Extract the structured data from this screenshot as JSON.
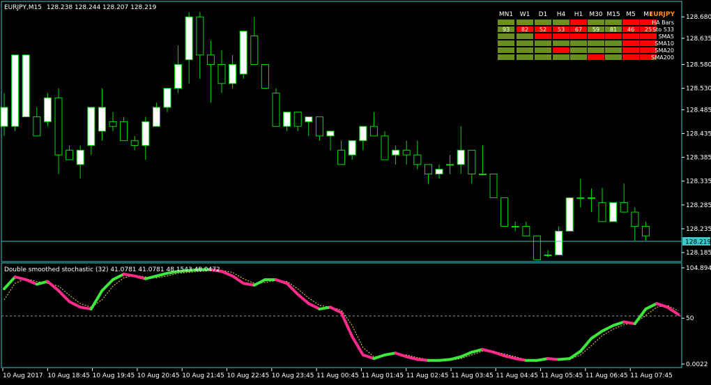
{
  "colors": {
    "background": "#000000",
    "frame": "#3ec9c9",
    "candle_line": "#00dc00",
    "candle_bull": "#ffffff",
    "candle_bear": "#000000",
    "price_line_bg": "#3ec9c9",
    "stoch_up": "#3ee63e",
    "stoch_down": "#ff2a8c",
    "signal": "#ffdd33",
    "mtf_ok": "#6b8e23",
    "mtf_bad": "#ff0000",
    "mtf_symbol": "#ff8c1a"
  },
  "main_header": {
    "symbol_tf": "EURJPY,M15",
    "ohlc": "128.238 128.244 128.207 128.219"
  },
  "current_price": "128.219",
  "sub_header": {
    "text": "Double smoothed stochastic (32) 41.0781 41.0781 48.1543 48.0472"
  },
  "mtf_panel": {
    "timeframes": [
      "MN1",
      "W1",
      "D1",
      "H4",
      "H1",
      "M30",
      "M15",
      "M5",
      "M1"
    ],
    "symbol": "EURJPY",
    "rows": [
      {
        "label": "HA Bars",
        "cells": [
          "g",
          "g",
          "g",
          "g",
          "r",
          "g",
          "g",
          "r",
          "r"
        ],
        "values": null
      },
      {
        "label": "Sto 533",
        "cells": [
          "g",
          "r",
          "r",
          "r",
          "r",
          "g",
          "g",
          "r",
          "r"
        ],
        "values": [
          "93",
          "82",
          "52",
          "53",
          "67",
          "59",
          "81",
          "46",
          "25"
        ]
      },
      {
        "label": "SMA5",
        "cells": [
          "g",
          "g",
          "r",
          "r",
          "r",
          "r",
          "r",
          "r",
          "r"
        ],
        "values": null
      },
      {
        "label": "SMA10",
        "cells": [
          "g",
          "g",
          "g",
          "g",
          "g",
          "g",
          "g",
          "r",
          "r"
        ],
        "values": null
      },
      {
        "label": "SMA20",
        "cells": [
          "g",
          "g",
          "g",
          "r",
          "g",
          "g",
          "g",
          "r",
          "r"
        ],
        "values": null
      },
      {
        "label": "SMA200",
        "cells": [
          "g",
          "g",
          "g",
          "g",
          "g",
          "r",
          "g",
          "r",
          "r"
        ],
        "values": null
      }
    ]
  },
  "chart_data": [
    {
      "type": "candlestick",
      "title": "EURJPY,M15",
      "ylim": [
        128.172,
        128.692
      ],
      "y_ticks": [
        "128.680",
        "128.635",
        "128.580",
        "128.530",
        "128.485",
        "128.435",
        "128.385",
        "128.335",
        "128.285",
        "128.235",
        "128.185"
      ],
      "x_ticks": [
        "10 Aug 2017",
        "10 Aug 18:45",
        "10 Aug 19:45",
        "10 Aug 20:45",
        "10 Aug 21:45",
        "10 Aug 22:45",
        "10 Aug 23:45",
        "11 Aug 00:45",
        "11 Aug 01:45",
        "11 Aug 02:45",
        "11 Aug 03:45",
        "11 Aug 04:45",
        "11 Aug 05:45",
        "11 Aug 06:45",
        "11 Aug 07:45"
      ],
      "candles": [
        {
          "o": 128.45,
          "h": 128.52,
          "l": 128.43,
          "c": 128.49
        },
        {
          "o": 128.45,
          "h": 128.6,
          "l": 128.44,
          "c": 128.6
        },
        {
          "o": 128.47,
          "h": 128.6,
          "l": 128.47,
          "c": 128.6
        },
        {
          "o": 128.47,
          "h": 128.49,
          "l": 128.46,
          "c": 128.43
        },
        {
          "o": 128.46,
          "h": 128.52,
          "l": 128.45,
          "c": 128.51
        },
        {
          "o": 128.51,
          "h": 128.53,
          "l": 128.35,
          "c": 128.39
        },
        {
          "o": 128.4,
          "h": 128.41,
          "l": 128.38,
          "c": 128.38
        },
        {
          "o": 128.37,
          "h": 128.41,
          "l": 128.34,
          "c": 128.4
        },
        {
          "o": 128.41,
          "h": 128.49,
          "l": 128.39,
          "c": 128.49
        },
        {
          "o": 128.44,
          "h": 128.53,
          "l": 128.42,
          "c": 128.49
        },
        {
          "o": 128.46,
          "h": 128.48,
          "l": 128.44,
          "c": 128.45
        },
        {
          "o": 128.46,
          "h": 128.47,
          "l": 128.42,
          "c": 128.42
        },
        {
          "o": 128.42,
          "h": 128.43,
          "l": 128.4,
          "c": 128.41
        },
        {
          "o": 128.41,
          "h": 128.47,
          "l": 128.38,
          "c": 128.46
        },
        {
          "o": 128.45,
          "h": 128.5,
          "l": 128.45,
          "c": 128.49
        },
        {
          "o": 128.49,
          "h": 128.53,
          "l": 128.48,
          "c": 128.53
        },
        {
          "o": 128.53,
          "h": 128.62,
          "l": 128.52,
          "c": 128.58
        },
        {
          "o": 128.59,
          "h": 128.69,
          "l": 128.54,
          "c": 128.68
        },
        {
          "o": 128.68,
          "h": 128.69,
          "l": 128.55,
          "c": 128.6
        },
        {
          "o": 128.6,
          "h": 128.63,
          "l": 128.5,
          "c": 128.58
        },
        {
          "o": 128.58,
          "h": 128.61,
          "l": 128.52,
          "c": 128.54
        },
        {
          "o": 128.54,
          "h": 128.6,
          "l": 128.53,
          "c": 128.58
        },
        {
          "o": 128.56,
          "h": 128.65,
          "l": 128.55,
          "c": 128.65
        },
        {
          "o": 128.64,
          "h": 128.68,
          "l": 128.58,
          "c": 128.58
        },
        {
          "o": 128.58,
          "h": 128.58,
          "l": 128.53,
          "c": 128.53
        },
        {
          "o": 128.52,
          "h": 128.53,
          "l": 128.45,
          "c": 128.45
        },
        {
          "o": 128.45,
          "h": 128.47,
          "l": 128.44,
          "c": 128.48
        },
        {
          "o": 128.48,
          "h": 128.48,
          "l": 128.44,
          "c": 128.45
        },
        {
          "o": 128.46,
          "h": 128.47,
          "l": 128.43,
          "c": 128.47
        },
        {
          "o": 128.47,
          "h": 128.47,
          "l": 128.42,
          "c": 128.43
        },
        {
          "o": 128.43,
          "h": 128.44,
          "l": 128.4,
          "c": 128.44
        },
        {
          "o": 128.4,
          "h": 128.42,
          "l": 128.37,
          "c": 128.37
        },
        {
          "o": 128.39,
          "h": 128.41,
          "l": 128.38,
          "c": 128.42
        },
        {
          "o": 128.42,
          "h": 128.45,
          "l": 128.4,
          "c": 128.45
        },
        {
          "o": 128.45,
          "h": 128.48,
          "l": 128.43,
          "c": 128.43
        },
        {
          "o": 128.43,
          "h": 128.44,
          "l": 128.38,
          "c": 128.38
        },
        {
          "o": 128.39,
          "h": 128.41,
          "l": 128.37,
          "c": 128.4
        },
        {
          "o": 128.4,
          "h": 128.42,
          "l": 128.37,
          "c": 128.39
        },
        {
          "o": 128.39,
          "h": 128.42,
          "l": 128.36,
          "c": 128.37
        },
        {
          "o": 128.37,
          "h": 128.37,
          "l": 128.33,
          "c": 128.35
        },
        {
          "o": 128.35,
          "h": 128.37,
          "l": 128.34,
          "c": 128.36
        },
        {
          "o": 128.37,
          "h": 128.39,
          "l": 128.35,
          "c": 128.37
        },
        {
          "o": 128.37,
          "h": 128.45,
          "l": 128.35,
          "c": 128.4
        },
        {
          "o": 128.4,
          "h": 128.4,
          "l": 128.33,
          "c": 128.35
        },
        {
          "o": 128.35,
          "h": 128.41,
          "l": 128.35,
          "c": 128.35
        },
        {
          "o": 128.35,
          "h": 128.35,
          "l": 128.3,
          "c": 128.3
        },
        {
          "o": 128.3,
          "h": 128.3,
          "l": 128.24,
          "c": 128.24
        },
        {
          "o": 128.24,
          "h": 128.25,
          "l": 128.23,
          "c": 128.24
        },
        {
          "o": 128.24,
          "h": 128.25,
          "l": 128.22,
          "c": 128.22
        },
        {
          "o": 128.22,
          "h": 128.22,
          "l": 128.19,
          "c": 128.17
        },
        {
          "o": 128.18,
          "h": 128.19,
          "l": 128.175,
          "c": 128.18
        },
        {
          "o": 128.18,
          "h": 128.24,
          "l": 128.18,
          "c": 128.23
        },
        {
          "o": 128.23,
          "h": 128.3,
          "l": 128.23,
          "c": 128.3
        },
        {
          "o": 128.3,
          "h": 128.34,
          "l": 128.28,
          "c": 128.3
        },
        {
          "o": 128.3,
          "h": 128.32,
          "l": 128.27,
          "c": 128.3
        },
        {
          "o": 128.29,
          "h": 128.32,
          "l": 128.25,
          "c": 128.25
        },
        {
          "o": 128.25,
          "h": 128.29,
          "l": 128.25,
          "c": 128.29
        },
        {
          "o": 128.29,
          "h": 128.33,
          "l": 128.27,
          "c": 128.27
        },
        {
          "o": 128.27,
          "h": 128.28,
          "l": 128.21,
          "c": 128.24
        },
        {
          "o": 128.24,
          "h": 128.25,
          "l": 128.21,
          "c": 128.22
        }
      ]
    },
    {
      "type": "line",
      "title": "Double smoothed stochastic (32)",
      "ylim": [
        0,
        104.8949
      ],
      "y_ticks": [
        "104.8949",
        "50",
        "0.0022"
      ],
      "level": 50,
      "series": [
        {
          "values": [
            82,
            95,
            92,
            87,
            90,
            80,
            68,
            62,
            60,
            80,
            92,
            98,
            96,
            93,
            96,
            99,
            101,
            102,
            103,
            103,
            101,
            96,
            88,
            86,
            92,
            92,
            88,
            76,
            66,
            60,
            62,
            56,
            30,
            10,
            6,
            10,
            12,
            8,
            5,
            4,
            4,
            5,
            8,
            13,
            16,
            13,
            9,
            6,
            4,
            4,
            6,
            5,
            6,
            14,
            28,
            36,
            42,
            46,
            44,
            60,
            66,
            62,
            54
          ]
        },
        {
          "values": [
            70,
            88,
            93,
            90,
            88,
            85,
            75,
            66,
            62,
            70,
            85,
            94,
            97,
            95,
            94,
            96,
            99,
            100,
            101,
            102,
            102,
            100,
            93,
            88,
            89,
            91,
            90,
            82,
            72,
            64,
            62,
            59,
            42,
            18,
            8,
            9,
            11,
            10,
            7,
            5,
            4,
            4,
            6,
            10,
            14,
            14,
            11,
            8,
            5,
            4,
            5,
            5,
            5,
            10,
            20,
            31,
            38,
            43,
            45,
            53,
            62,
            64,
            58
          ]
        }
      ]
    }
  ]
}
